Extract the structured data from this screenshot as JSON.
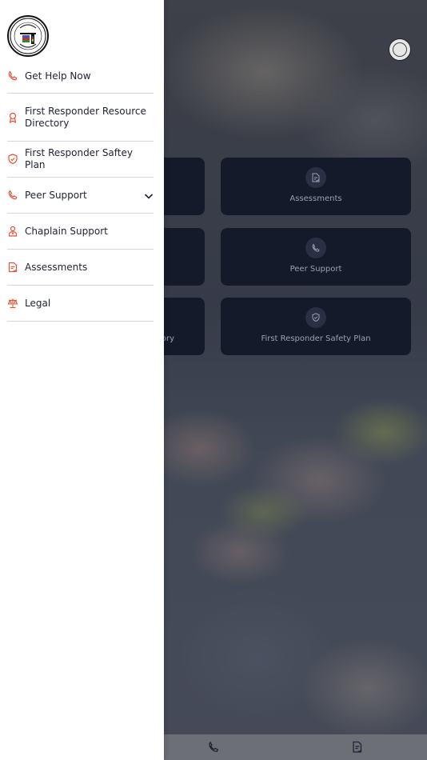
{
  "drawer": {
    "menu": [
      {
        "label": "Get Help Now",
        "icon": "phone-icon"
      },
      {
        "label": "First Responder Resource Directory",
        "icon": "award-ribbon-icon"
      },
      {
        "label": "First Responder Saftey Plan",
        "icon": "shield-check-icon"
      },
      {
        "label": "Peer Support",
        "icon": "phone-icon",
        "expandable": true
      },
      {
        "label": "Chaplain Support",
        "icon": "chaplain-person-icon"
      },
      {
        "label": "Assessments",
        "icon": "document-check-icon"
      },
      {
        "label": "Legal",
        "icon": "scales-icon"
      }
    ]
  },
  "main": {
    "cards": [
      {
        "label": "Assessments",
        "icon": "document-check-icon"
      },
      {
        "label": "Peer Support",
        "icon": "phone-icon"
      },
      {
        "label": "First Responder Safety Plan",
        "icon": "shield-check-icon"
      },
      {
        "label": "ory",
        "icon": ""
      }
    ]
  },
  "bottom_nav": {
    "items": [
      "phone-icon",
      "document-check-icon"
    ]
  },
  "colors": {
    "accent": "#e8503a",
    "drawer_bg": "#ffffff",
    "card_bg": "#151a2a",
    "text": "#1e2233"
  }
}
